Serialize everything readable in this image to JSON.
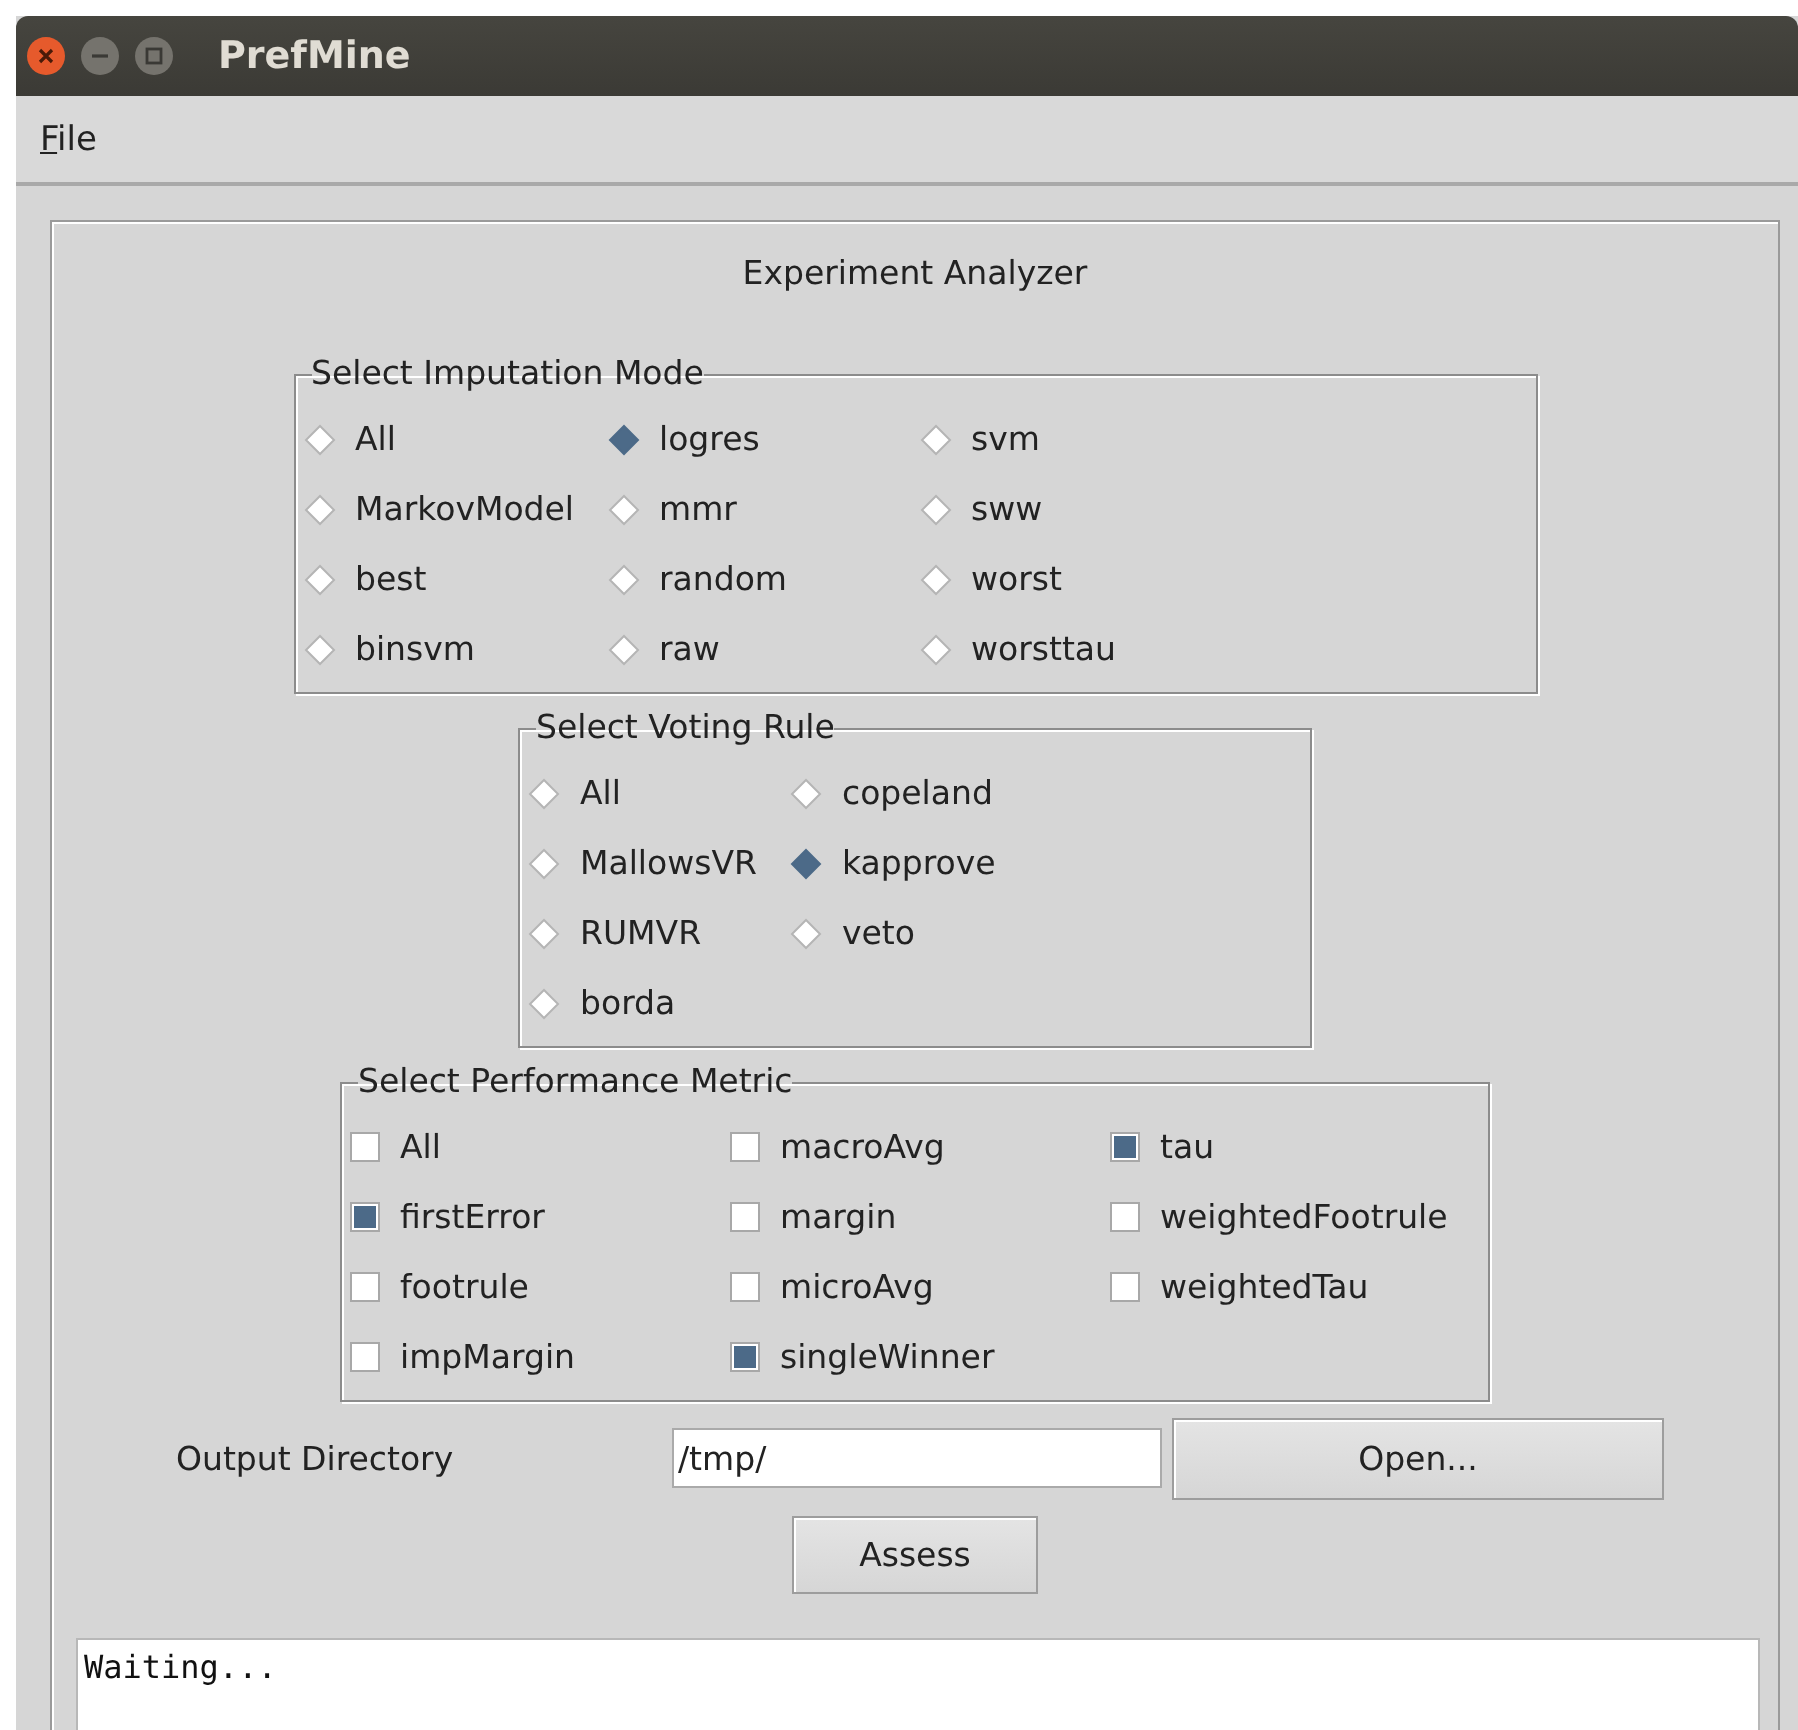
{
  "window": {
    "title": "PrefMine"
  },
  "menu": [
    {
      "label": "File"
    }
  ],
  "panel": {
    "title": "Experiment Analyzer"
  },
  "groups": [
    {
      "kind": "radio",
      "title": "Select Imputation Mode",
      "options": [
        {
          "label": "All",
          "selected": false
        },
        {
          "label": "logres",
          "selected": true
        },
        {
          "label": "svm",
          "selected": false
        },
        {
          "label": "MarkovModel",
          "selected": false
        },
        {
          "label": "mmr",
          "selected": false
        },
        {
          "label": "sww",
          "selected": false
        },
        {
          "label": "best",
          "selected": false
        },
        {
          "label": "random",
          "selected": false
        },
        {
          "label": "worst",
          "selected": false
        },
        {
          "label": "binsvm",
          "selected": false
        },
        {
          "label": "raw",
          "selected": false
        },
        {
          "label": "worsttau",
          "selected": false
        }
      ]
    },
    {
      "kind": "radio",
      "title": "Select Voting Rule",
      "options": [
        {
          "label": "All",
          "selected": false
        },
        {
          "label": "copeland",
          "selected": false
        },
        {
          "label": "MallowsVR",
          "selected": false
        },
        {
          "label": "kapprove",
          "selected": true
        },
        {
          "label": "RUMVR",
          "selected": false
        },
        {
          "label": "veto",
          "selected": false
        },
        {
          "label": "borda",
          "selected": false
        }
      ]
    },
    {
      "kind": "checkbox",
      "title": "Select Performance Metric",
      "options": [
        {
          "label": "All",
          "checked": false
        },
        {
          "label": "macroAvg",
          "checked": false
        },
        {
          "label": "tau",
          "checked": true
        },
        {
          "label": "firstError",
          "checked": true
        },
        {
          "label": "margin",
          "checked": false
        },
        {
          "label": "weightedFootrule",
          "checked": false
        },
        {
          "label": "footrule",
          "checked": false
        },
        {
          "label": "microAvg",
          "checked": false
        },
        {
          "label": "weightedTau",
          "checked": false
        },
        {
          "label": "impMargin",
          "checked": false
        },
        {
          "label": "singleWinner",
          "checked": true
        }
      ]
    }
  ],
  "output": {
    "label": "Output Directory",
    "value": "/tmp/",
    "button": "Open..."
  },
  "assess_button": "Assess",
  "log": {
    "text": "Waiting..."
  }
}
